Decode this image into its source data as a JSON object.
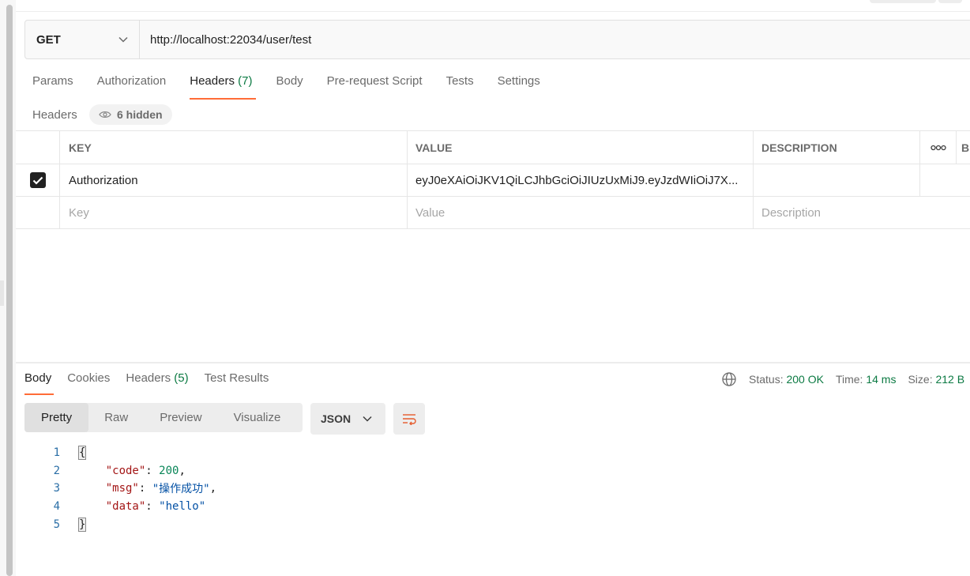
{
  "request": {
    "method": "GET",
    "url": "http://localhost:22034/user/test"
  },
  "request_tabs": [
    {
      "label": "Params"
    },
    {
      "label": "Authorization"
    },
    {
      "label": "Headers",
      "count": "(7)"
    },
    {
      "label": "Body"
    },
    {
      "label": "Pre-request Script"
    },
    {
      "label": "Tests"
    },
    {
      "label": "Settings"
    }
  ],
  "headers_section": {
    "title": "Headers",
    "hidden_label": "6 hidden"
  },
  "table": {
    "columns": [
      "KEY",
      "VALUE",
      "DESCRIPTION",
      "ooo",
      "B"
    ],
    "rows": [
      {
        "checked": true,
        "key": "Authorization",
        "value": "eyJ0eXAiOiJKV1QiLCJhbGciOiJIUzUxMiJ9.eyJzdWIiOiJ7X...",
        "description": ""
      }
    ],
    "placeholder": {
      "key": "Key",
      "value": "Value",
      "description": "Description"
    }
  },
  "response_tabs": [
    {
      "label": "Body"
    },
    {
      "label": "Cookies"
    },
    {
      "label": "Headers",
      "count": "(5)"
    },
    {
      "label": "Test Results"
    }
  ],
  "status": {
    "status_label": "Status:",
    "status_value": "200 OK",
    "time_label": "Time:",
    "time_value": "14 ms",
    "size_label": "Size:",
    "size_value": "212 B"
  },
  "view_tabs": [
    "Pretty",
    "Raw",
    "Preview",
    "Visualize"
  ],
  "format": "JSON",
  "code": {
    "line_numbers": [
      "1",
      "2",
      "3",
      "4",
      "5"
    ],
    "open": "{",
    "close": "}",
    "code_key": "\"code\"",
    "code_value": "200",
    "msg_key": "\"msg\"",
    "msg_value": "\"操作成功\"",
    "data_key": "\"data\"",
    "data_value": "\"hello\""
  },
  "colors": {
    "accent": "#ff6c37",
    "success": "#0c7a43"
  }
}
